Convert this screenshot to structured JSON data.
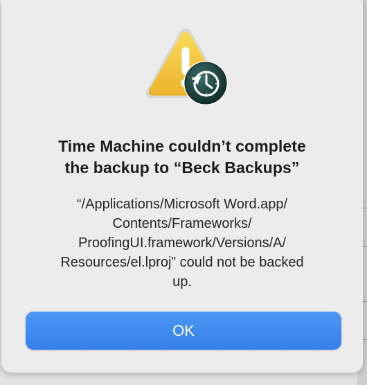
{
  "dialog": {
    "icon": "caution-triangle-with-time-machine-badge",
    "title_line1": "Time Machine couldn’t complete",
    "title_line2": "the backup to “Beck Backups”",
    "message_lines": [
      "“/Applications/Microsoft Word.app/",
      "Contents/Frameworks/",
      "ProofingUI.framework/Versions/A/",
      "Resources/el.lproj” could not be backed",
      "up."
    ],
    "ok_label": "OK"
  },
  "colors": {
    "accent": "#3a86ee",
    "warning_yellow": "#f2c233",
    "badge_dark": "#1f4440"
  }
}
